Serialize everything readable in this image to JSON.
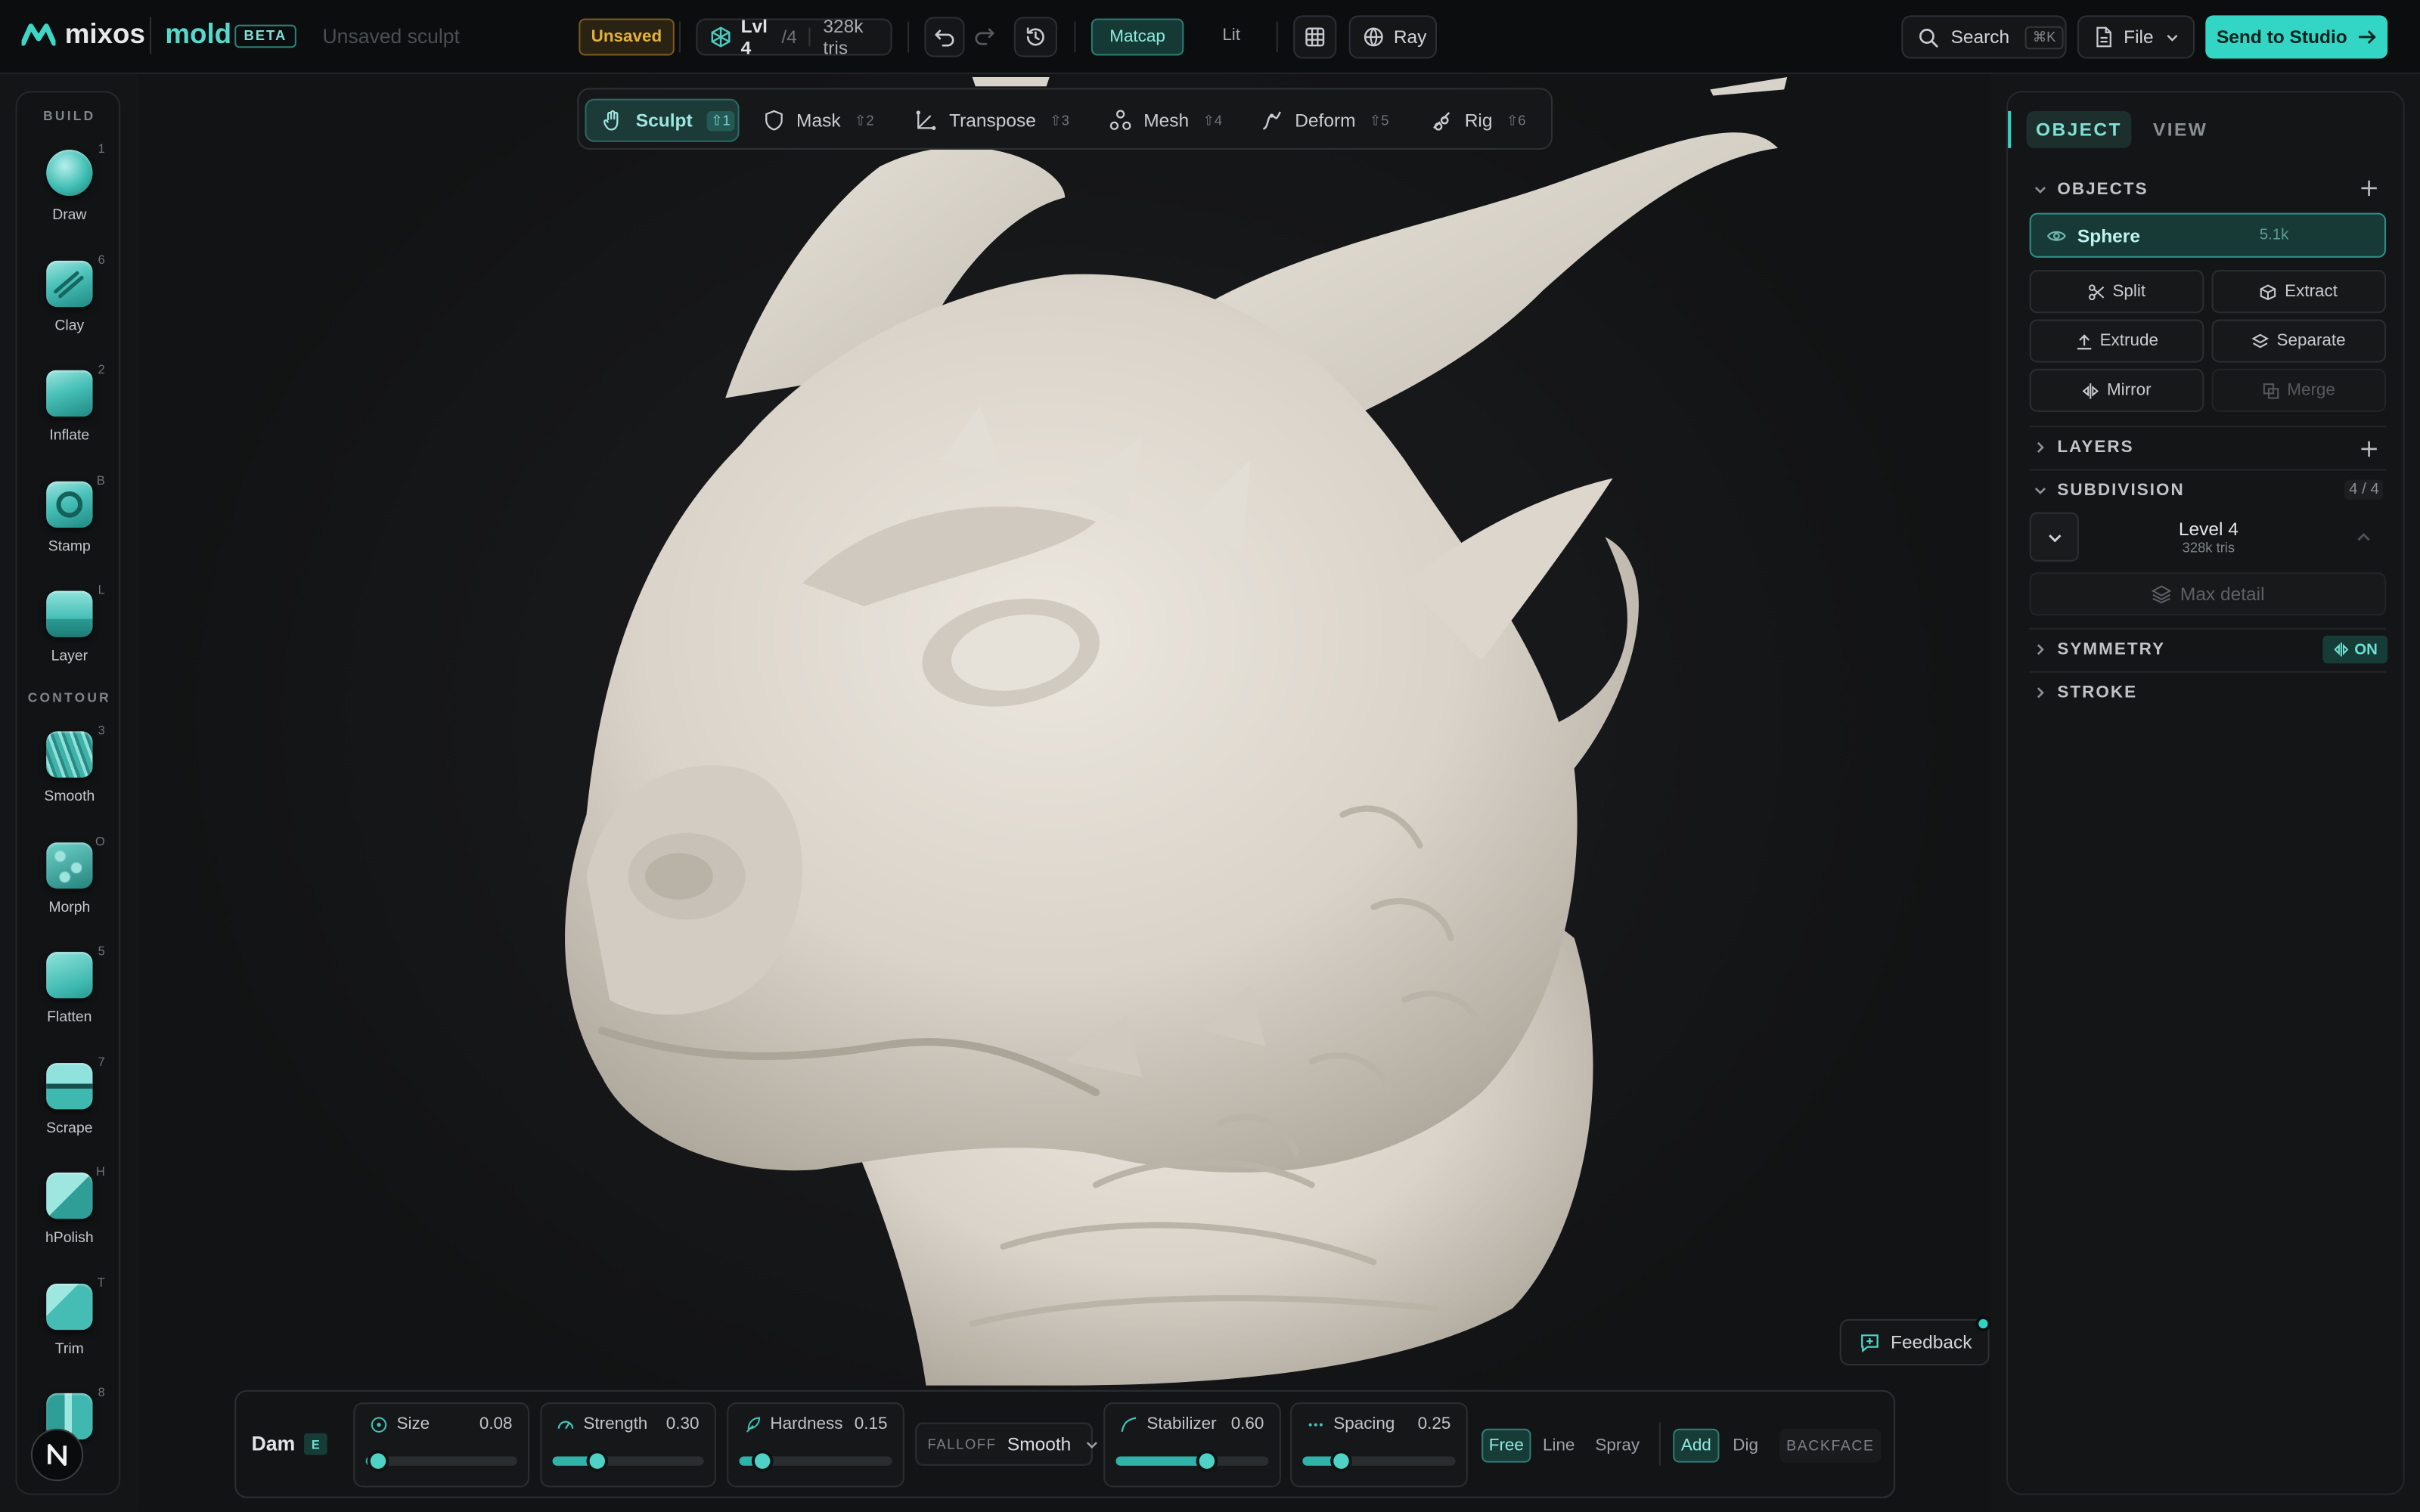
{
  "app": {
    "brand": "mixos",
    "product": "mold",
    "badge": "BETA",
    "doc_title": "Unsaved sculpt",
    "status": "Unsaved",
    "level_label": "Lvl 4",
    "level_total": "/4",
    "tris": "328k tris"
  },
  "toolbar": {
    "matcap_label": "Matcap",
    "lit_label": "Lit",
    "ray_label": "Ray",
    "search_label": "Search",
    "search_shortcut": "⌘K",
    "file_label": "File",
    "send_label": "Send to Studio"
  },
  "mode_tabs": [
    {
      "label": "Sculpt",
      "key": "⇧1",
      "icon": "hand-icon",
      "active": true
    },
    {
      "label": "Mask",
      "key": "⇧2",
      "icon": "shield-icon",
      "active": false
    },
    {
      "label": "Transpose",
      "key": "⇧3",
      "icon": "transpose-icon",
      "active": false
    },
    {
      "label": "Mesh",
      "key": "⇧4",
      "icon": "mesh-icon",
      "active": false
    },
    {
      "label": "Deform",
      "key": "⇧5",
      "icon": "deform-icon",
      "active": false
    },
    {
      "label": "Rig",
      "key": "⇧6",
      "icon": "rig-icon",
      "active": false
    }
  ],
  "left_toolbar": {
    "build_label": "BUILD",
    "contour_label": "CONTOUR",
    "build_tools": [
      {
        "label": "Draw",
        "key": "1"
      },
      {
        "label": "Clay",
        "key": "6"
      },
      {
        "label": "Inflate",
        "key": "2"
      },
      {
        "label": "Stamp",
        "key": "B"
      },
      {
        "label": "Layer",
        "key": "L"
      }
    ],
    "contour_tools": [
      {
        "label": "Smooth",
        "key": "3"
      },
      {
        "label": "Morph",
        "key": "O"
      },
      {
        "label": "Flatten",
        "key": "5"
      },
      {
        "label": "Scrape",
        "key": "7"
      },
      {
        "label": "hPolish",
        "key": "H"
      },
      {
        "label": "Trim",
        "key": "T"
      },
      {
        "label": "",
        "key": "8"
      }
    ]
  },
  "right_panel": {
    "tabs": [
      "OBJECT",
      "VIEW"
    ],
    "objects_label": "OBJECTS",
    "object_name": "Sphere",
    "object_count": "5.1k",
    "actions": [
      "Split",
      "Extract",
      "Extrude",
      "Separate",
      "Mirror",
      "Merge"
    ],
    "layers_label": "LAYERS",
    "subdivision_label": "SUBDIVISION",
    "subdivision_count": "4 / 4",
    "level_title": "Level 4",
    "level_tris": "328k tris",
    "max_detail": "Max detail",
    "symmetry_label": "SYMMETRY",
    "symmetry_state": "ON",
    "stroke_label": "STROKE"
  },
  "brush": {
    "name": "Dam",
    "key": "E",
    "size_label": "Size",
    "size_value": "0.08",
    "size": 0.08,
    "strength_label": "Strength",
    "strength_value": "0.30",
    "strength": 0.3,
    "hardness_label": "Hardness",
    "hardness_value": "0.15",
    "hardness": 0.15,
    "falloff_label": "FALLOFF",
    "falloff_value": "Smooth",
    "stabilizer_label": "Stabilizer",
    "stabilizer_value": "0.60",
    "stabilizer": 0.6,
    "spacing_label": "Spacing",
    "spacing_value": "0.25",
    "spacing": 0.25,
    "stroke_modes": [
      "Free",
      "Line",
      "Spray"
    ],
    "stroke_active": "Free",
    "ops": [
      "Add",
      "Dig"
    ],
    "op_active": "Add",
    "backface_label": "BACKFACE"
  },
  "feedback_label": "Feedback",
  "colors": {
    "accent": "#2fd3c3",
    "send_button": "#33d6c4",
    "unsaved": "#e3b13a"
  }
}
